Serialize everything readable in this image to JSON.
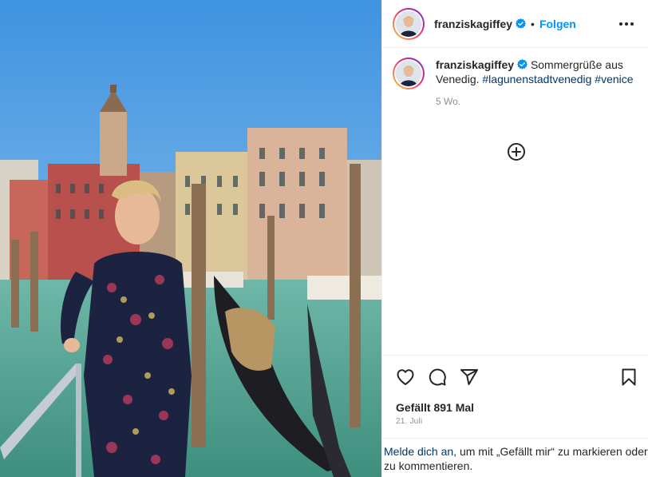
{
  "photo": {
    "icon": "venice-photo",
    "subject": "woman-on-gondola-pier-icon"
  },
  "header": {
    "username": "franziskagiffey",
    "separator": "•",
    "follow_label": "Folgen",
    "verified_icon": "verified-badge-icon",
    "more_icon": "more-options-icon"
  },
  "caption": {
    "username": "franziskagiffey",
    "text": "Sommergrüße aus Venedig.",
    "hashtags": [
      "#lagunenstadtvenedig",
      "#venice"
    ],
    "time": "5 Wo."
  },
  "add_comment_icon": "add-circle-icon",
  "actions": {
    "like_icon": "heart-icon",
    "comment_icon": "comment-icon",
    "share_icon": "send-icon",
    "save_icon": "bookmark-icon",
    "likes_text": "Gefällt 891 Mal",
    "date": "21. Juli"
  },
  "login_prompt": {
    "link": "Melde dich an",
    "text": ", um mit „Gefällt mir“ zu markieren oder zu kommentieren."
  },
  "colors": {
    "accent": "#0095f6",
    "hashtag": "#00376b",
    "muted": "#8e8e8e",
    "text": "#262626",
    "verified": "#0095f6"
  }
}
